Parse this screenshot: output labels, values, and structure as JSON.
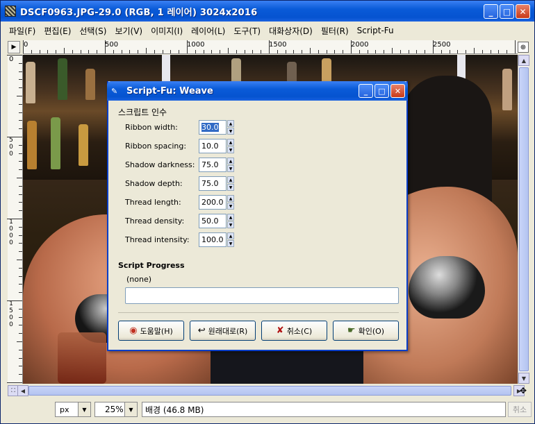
{
  "window": {
    "title": "DSCF0963.JPG-29.0 (RGB, 1 레이어) 3024x2016",
    "controls": {
      "minimize": "_",
      "maximize": "□",
      "close": "✕"
    }
  },
  "menu": [
    "파일(F)",
    "편집(E)",
    "선택(S)",
    "보기(V)",
    "이미지(I)",
    "레이어(L)",
    "도구(T)",
    "대화상자(D)",
    "필터(R)",
    "Script-Fu"
  ],
  "ruler": {
    "h_labels": [
      "0",
      "500",
      "1000",
      "1500",
      "2000",
      "2500"
    ],
    "v_labels": [
      "0",
      "500",
      "1000",
      "1500"
    ]
  },
  "dialog": {
    "title": "Script-Fu: Weave",
    "section": "스크립트 인수",
    "params": [
      {
        "label": "Ribbon width:",
        "value": "30.0"
      },
      {
        "label": "Ribbon spacing:",
        "value": "10.0"
      },
      {
        "label": "Shadow darkness:",
        "value": "75.0"
      },
      {
        "label": "Shadow depth:",
        "value": "75.0"
      },
      {
        "label": "Thread length:",
        "value": "200.0"
      },
      {
        "label": "Thread density:",
        "value": "50.0"
      },
      {
        "label": "Thread intensity:",
        "value": "100.0"
      }
    ],
    "progress_title": "Script Progress",
    "progress_status": "(none)",
    "buttons": {
      "help": "도움말(H)",
      "reset": "원래대로(R)",
      "cancel": "취소(C)",
      "ok": "확인(O)"
    }
  },
  "status": {
    "unit": "px",
    "zoom": "25%",
    "text": "배경  (46.8 MB)",
    "cancel": "취소"
  }
}
